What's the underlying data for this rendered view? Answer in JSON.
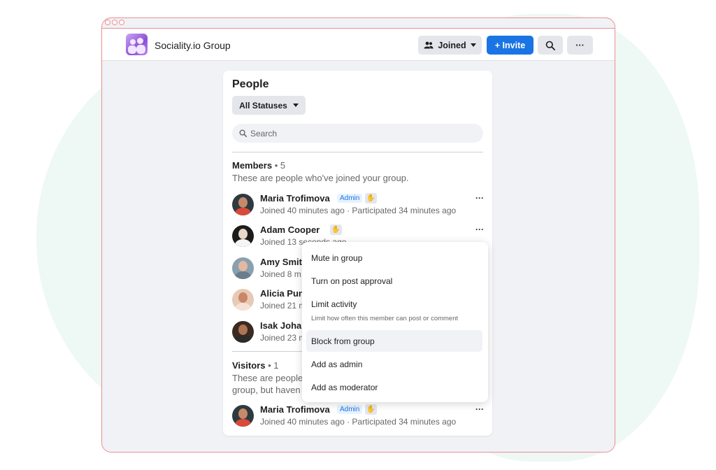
{
  "header": {
    "group_name": "Sociality.io Group",
    "joined_label": "Joined",
    "invite_label": "+ Invite",
    "more_label": "···"
  },
  "people": {
    "title": "People",
    "filter_label": "All Statuses",
    "search_placeholder": "Search",
    "members": {
      "title": "Members",
      "count": "• 5",
      "description": "These are people who've joined your group.",
      "items": [
        {
          "name": "Maria Trofimova",
          "badge": "Admin",
          "sub": "Joined 40 minutes ago · Participated 34 minutes ago"
        },
        {
          "name": "Adam Cooper",
          "badge": "",
          "sub": "Joined 13 seconds ago"
        },
        {
          "name": "Amy Smit",
          "badge": "",
          "sub": "Joined 8 m"
        },
        {
          "name": "Alicia Pun",
          "badge": "",
          "sub": "Joined 21 m"
        },
        {
          "name": "Isak Johan",
          "badge": "",
          "sub": "Joined 23 m"
        }
      ]
    },
    "visitors": {
      "title": "Visitors",
      "count": "• 1",
      "description_line1": "These are people",
      "description_line2": "group, but haven",
      "items": [
        {
          "name": "Maria Trofimova",
          "badge": "Admin",
          "sub": "Joined 40 minutes ago · Participated 34 minutes ago"
        }
      ]
    }
  },
  "menu": {
    "mute": "Mute in group",
    "post_approval": "Turn on post approval",
    "limit": "Limit activity",
    "limit_desc": "Limit how often this member can post or comment",
    "block": "Block from group",
    "add_admin": "Add as admin",
    "add_moderator": "Add as moderator"
  },
  "icons": {
    "joined": "people-icon",
    "search": "search-icon",
    "wave": "wave-icon",
    "caret": "caret-down-icon"
  },
  "colors": {
    "accent": "#1b74e4",
    "frame": "#ef8e93",
    "background": "#f0f2f5"
  }
}
